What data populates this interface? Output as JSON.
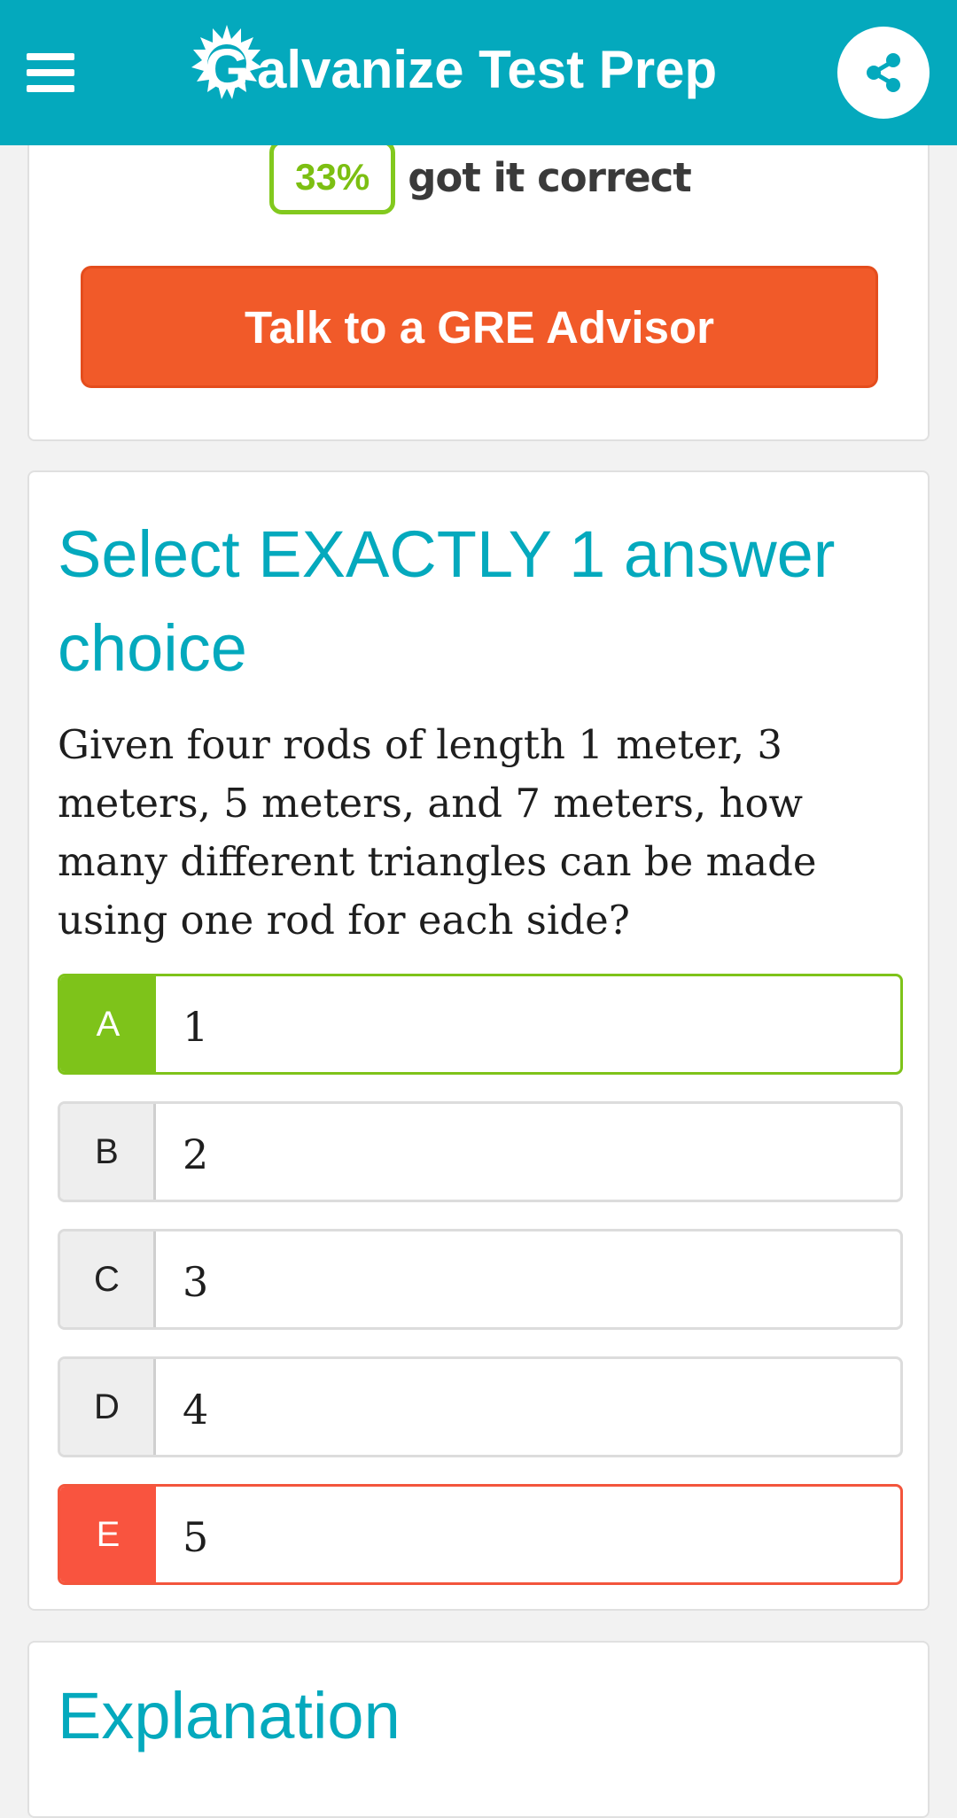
{
  "header": {
    "brand_name": "alvanize Test Prep",
    "brand_logo_letter": "G",
    "colors": {
      "background": "#04a9bd",
      "foreground": "#ffffff"
    },
    "icons": {
      "menu": "hamburger-menu-icon",
      "share": "share-icon"
    }
  },
  "stats": {
    "percent": "33%",
    "suffix": "got it correct",
    "advisor_button_label": "Talk to a GRE Advisor",
    "colors": {
      "badge": "#82c91e",
      "button": "#f15a29"
    }
  },
  "question": {
    "instruction": "Select EXACTLY 1 answer choice",
    "text": "Given four rods of length 1 meter, 3 meters, 5 meters, and 7 meters, how many different triangles can be made using one rod for each side?",
    "choices": [
      {
        "letter": "A",
        "value": "1",
        "state": "correct"
      },
      {
        "letter": "B",
        "value": "2",
        "state": "neutral"
      },
      {
        "letter": "C",
        "value": "3",
        "state": "neutral"
      },
      {
        "letter": "D",
        "value": "4",
        "state": "neutral"
      },
      {
        "letter": "E",
        "value": "5",
        "state": "incorrect"
      }
    ],
    "colors": {
      "correct": "#7ec31a",
      "incorrect": "#f9543f",
      "heading": "#04a9bd"
    }
  },
  "explanation": {
    "title": "Explanation"
  }
}
